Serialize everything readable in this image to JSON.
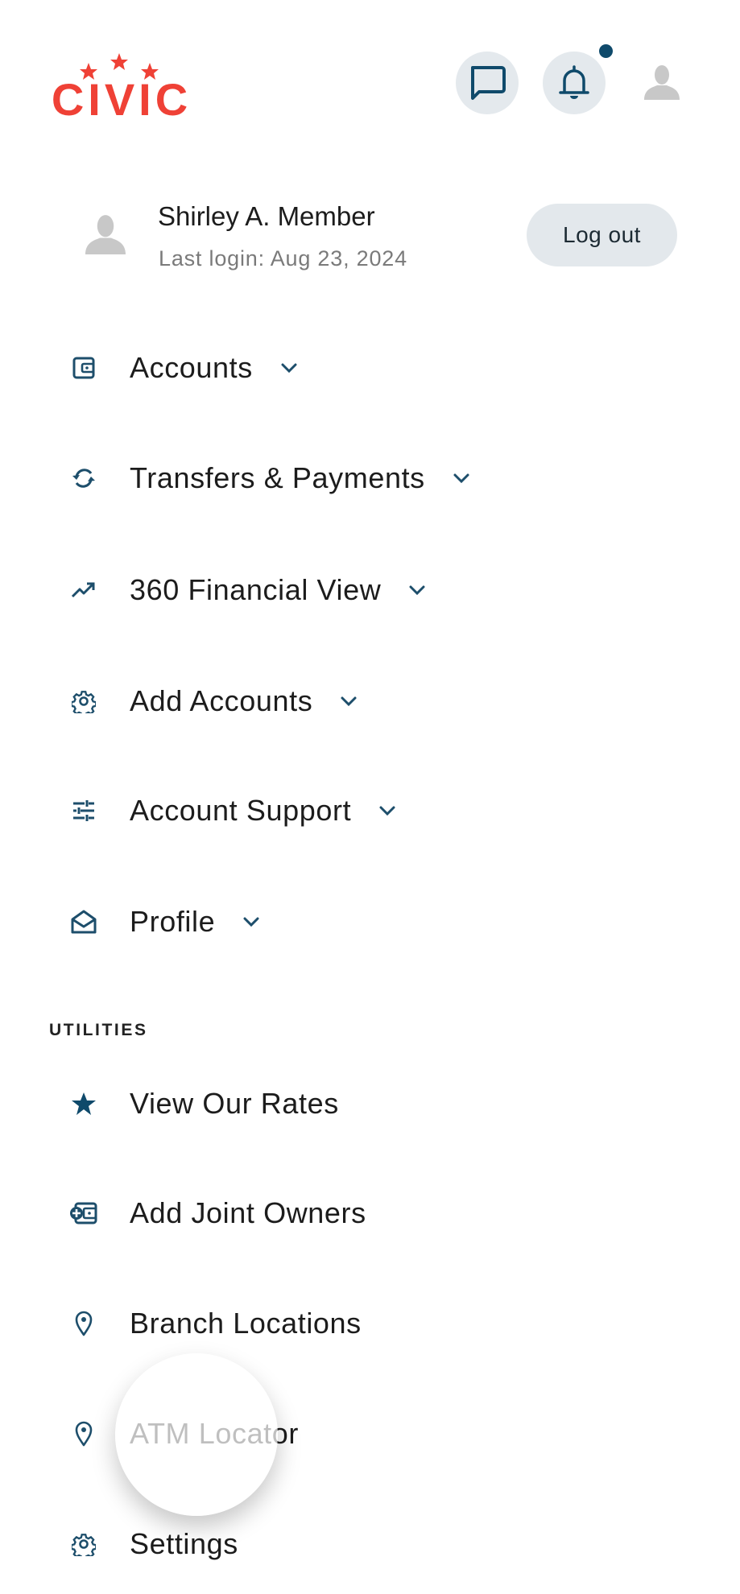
{
  "brand": {
    "name": "CIVIC",
    "color": "#ef4136"
  },
  "header": {
    "chat_icon": "chat-bubble-icon",
    "bell_icon": "bell-icon",
    "has_notification": true,
    "avatar_icon": "user-avatar-icon"
  },
  "user": {
    "name": "Shirley A. Member",
    "last_login": "Last login: Aug 23, 2024",
    "logout_label": "Log out"
  },
  "menu": [
    {
      "label": "Accounts",
      "icon": "wallet-icon",
      "expandable": true
    },
    {
      "label": "Transfers & Payments",
      "icon": "refresh-arrows-icon",
      "expandable": true
    },
    {
      "label": "360 Financial View",
      "icon": "trending-up-icon",
      "expandable": true
    },
    {
      "label": "Add Accounts",
      "icon": "gear-icon",
      "expandable": true
    },
    {
      "label": "Account Support",
      "icon": "sliders-icon",
      "expandable": true
    },
    {
      "label": "Profile",
      "icon": "open-envelope-icon",
      "expandable": true
    }
  ],
  "utilities": {
    "heading": "UTILITIES",
    "items": [
      {
        "label": "View Our Rates",
        "icon": "star-icon"
      },
      {
        "label": "Add Joint Owners",
        "icon": "wallet-add-icon"
      },
      {
        "label": "Branch Locations",
        "icon": "map-pin-icon"
      },
      {
        "label": "ATM Locator",
        "icon": "map-pin-icon"
      },
      {
        "label": "Settings",
        "icon": "gear-icon"
      }
    ]
  },
  "colors": {
    "icon": "#1d4e6b",
    "text": "#1c1c1c",
    "muted": "#7a7a7a",
    "button_bg": "#e3e8ec",
    "accent_dot": "#0f4a6b"
  }
}
